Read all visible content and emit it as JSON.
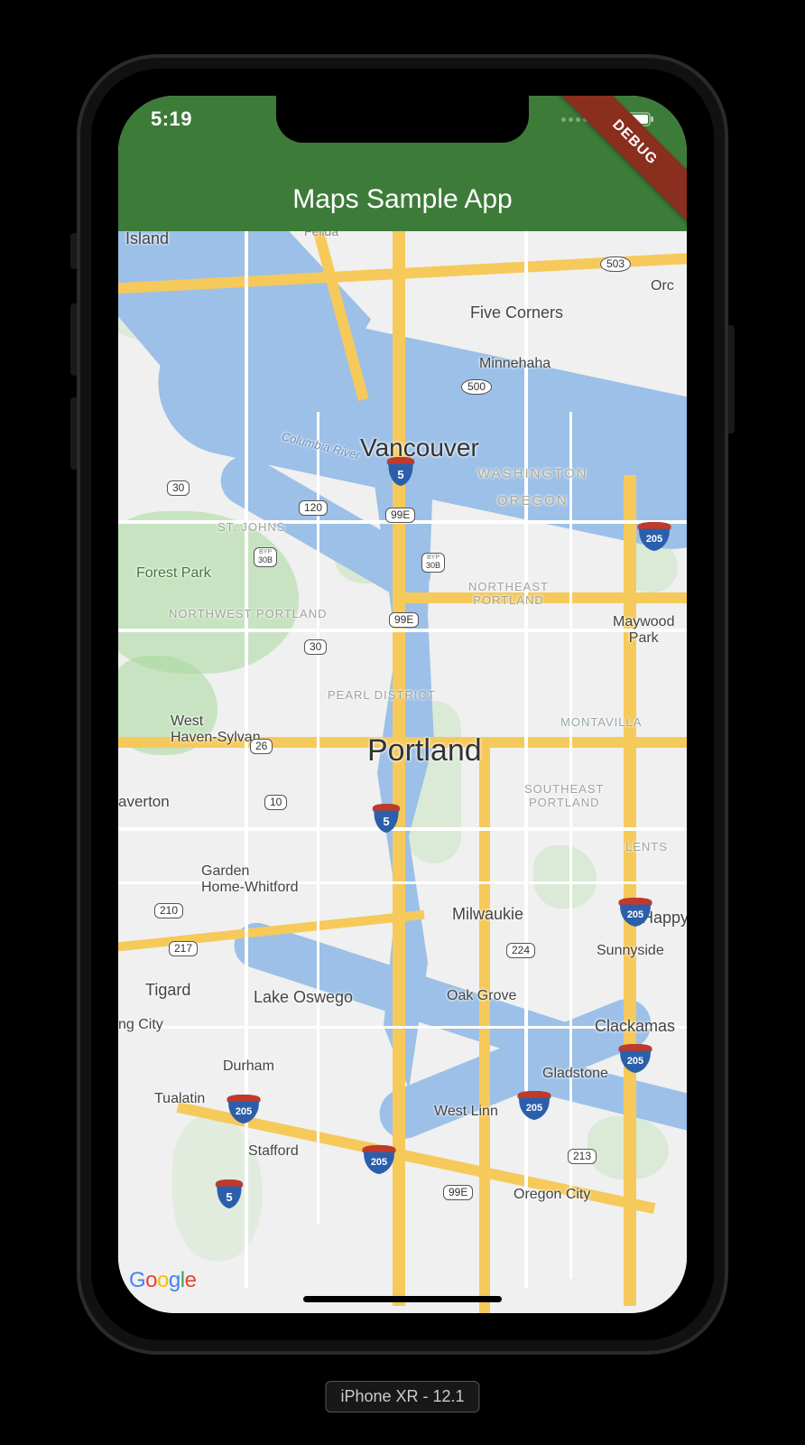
{
  "status": {
    "time": "5:19"
  },
  "app": {
    "title": "Maps Sample App"
  },
  "debug": {
    "label": "DEBUG"
  },
  "map": {
    "attribution": "Google",
    "center_label": "Portland",
    "labels": {
      "vancouver": "Vancouver",
      "island": "Island",
      "five_corners": "Five Corners",
      "orc": "Orc",
      "minnehaha": "Minnehaha",
      "felida": "Felida",
      "washington": "WASHINGTON",
      "oregon": "OREGON",
      "columbia_river": "Columbia River",
      "st_johns": "ST. JOHNS",
      "forest_park": "Forest Park",
      "nw_portland": "NORTHWEST PORTLAND",
      "ne_portland": "NORTHEAST\nPORTLAND",
      "maywood": "Maywood\nPark",
      "pearl": "PEARL DISTRICT",
      "montavilla": "MONTAVILLA",
      "w_haven": "West\nHaven-Sylvan",
      "se_portland": "SOUTHEAST\nPORTLAND",
      "lents": "LENTS",
      "beaverton": "averton",
      "garden_home": "Garden\nHome-Whitford",
      "milwaukie": "Milwaukie",
      "happy": "Happy",
      "sunnyside": "Sunnyside",
      "tigard": "Tigard",
      "lake_oswego": "Lake Oswego",
      "oak_grove": "Oak Grove",
      "clackamas": "Clackamas",
      "ng_city": "ng City",
      "durham": "Durham",
      "gladstone": "Gladstone",
      "tualatin": "Tualatin",
      "stafford": "Stafford",
      "west_linn": "West Linn",
      "oregon_city": "Oregon City"
    },
    "shields": {
      "s503": "503",
      "s500": "500",
      "s30": "30",
      "s120": "120",
      "s99e_a": "99E",
      "s30b_a": "30B",
      "s30b_b": "30B",
      "s99e_b": "99E",
      "s30_c": "30",
      "s26": "26",
      "s10": "10",
      "s210": "210",
      "s217": "217",
      "s224": "224",
      "s213": "213",
      "s99e_c": "99E",
      "i5_a": "5",
      "i5_b": "5",
      "i5_c": "5",
      "i205_a": "205",
      "i205_b": "205",
      "i205_c": "205",
      "i205_d": "205",
      "i205_e": "205",
      "i205_f": "205"
    }
  },
  "simulator": {
    "label": "iPhone XR - 12.1"
  }
}
